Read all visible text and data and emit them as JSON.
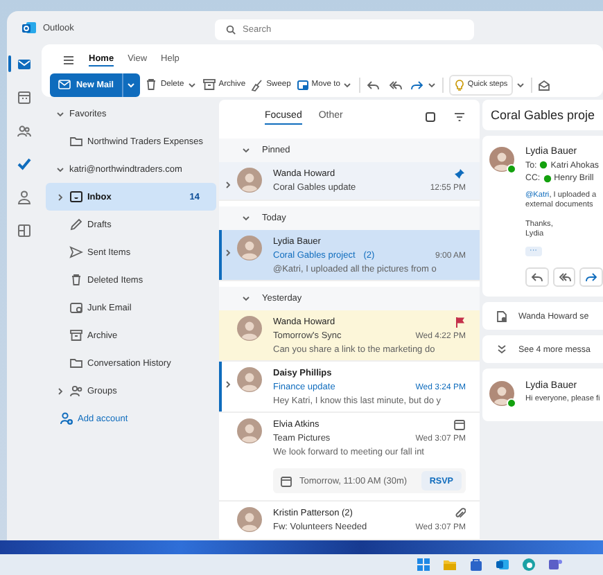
{
  "app": {
    "name": "Outlook"
  },
  "search": {
    "placeholder": "Search"
  },
  "rail": [
    {
      "kind": "mail",
      "selected": true
    },
    {
      "kind": "calendar",
      "selected": false
    },
    {
      "kind": "people",
      "selected": false
    },
    {
      "kind": "todo",
      "selected": false
    },
    {
      "kind": "person",
      "selected": false
    },
    {
      "kind": "apps",
      "selected": false
    }
  ],
  "ribbon": {
    "tabs": [
      {
        "label": "Home",
        "selected": true
      },
      {
        "label": "View",
        "selected": false
      },
      {
        "label": "Help",
        "selected": false
      }
    ],
    "new_mail": "New Mail",
    "actions": [
      {
        "label": "Delete",
        "kind": "trash",
        "dropdown": true
      },
      {
        "label": "Archive",
        "kind": "archive",
        "dropdown": false
      },
      {
        "label": "Sweep",
        "kind": "broom",
        "dropdown": false
      },
      {
        "label": "Move to",
        "kind": "move",
        "dropdown": true
      }
    ],
    "quick_steps": "Quick steps"
  },
  "folders": {
    "favorites": {
      "label": "Favorites",
      "expanded": true,
      "items": [
        {
          "label": "Northwind Traders Expenses",
          "kind": "folder"
        }
      ]
    },
    "account": {
      "label": "katri@northwindtraders.com",
      "expanded": true,
      "items": [
        {
          "label": "Inbox",
          "kind": "inbox",
          "count": "14",
          "selected": true
        },
        {
          "label": "Drafts",
          "kind": "drafts",
          "selected": false
        },
        {
          "label": "Sent Items",
          "kind": "sent",
          "selected": false
        },
        {
          "label": "Deleted Items",
          "kind": "trash",
          "selected": false
        },
        {
          "label": "Junk Email",
          "kind": "junk",
          "selected": false
        },
        {
          "label": "Archive",
          "kind": "archive",
          "selected": false
        },
        {
          "label": "Conversation History",
          "kind": "folder",
          "selected": false
        }
      ]
    },
    "groups": {
      "label": "Groups",
      "expanded": false
    },
    "add_account": "Add account"
  },
  "list": {
    "tabs": [
      {
        "label": "Focused",
        "selected": true
      },
      {
        "label": "Other",
        "selected": false
      }
    ],
    "sections": [
      {
        "label": "Pinned",
        "messages": [
          {
            "sender": "Wanda Howard",
            "subject": "Coral Gables update",
            "time": "12:55 PM",
            "kind": "pinned",
            "selected": false,
            "unread": false,
            "thread": true
          }
        ]
      },
      {
        "label": "Today",
        "messages": [
          {
            "sender": "Lydia Bauer",
            "subject": "Coral Gables project",
            "count": "(2)",
            "time": "9:00 AM",
            "kind": "plain",
            "preview": "@Katri, I uploaded all the pictures from o",
            "selected": true,
            "unread": false,
            "thread": true
          }
        ]
      },
      {
        "label": "Yesterday",
        "messages": [
          {
            "sender": "Wanda Howard",
            "subject": "Tomorrow's Sync",
            "time": "Wed 4:22 PM",
            "preview": "Can you share a link to the marketing do",
            "kind": "flagged",
            "selected": false,
            "unread": false,
            "thread": false
          },
          {
            "sender": "Daisy Phillips",
            "subject": "Finance update",
            "time": "Wed 3:24 PM",
            "kind": "plain",
            "preview": "Hey Katri, I know this last minute, but do y",
            "selected": false,
            "unread": true,
            "thread": true
          },
          {
            "sender": "Elvia Atkins",
            "subject": "Team Pictures",
            "time": "Wed 3:07 PM",
            "preview": "We look forward to meeting our fall int",
            "kind": "event",
            "selected": false,
            "unread": false,
            "thread": false,
            "invite": {
              "when": "Tomorrow, 11:00 AM (30m)",
              "action": "RSVP"
            }
          },
          {
            "sender": "Kristin Patterson (2)",
            "subject": "Fw: Volunteers Needed",
            "time": "Wed 3:07 PM",
            "kind": "attachment",
            "selected": false,
            "unread": false,
            "thread": false
          }
        ]
      }
    ]
  },
  "reading": {
    "subject": "Coral Gables proje",
    "message": {
      "sender": "Lydia Bauer",
      "to_label": "To:",
      "to": "Katri Ahokas",
      "cc_label": "CC:",
      "cc": "Henry Brill",
      "body": [
        {
          "mention": "@Katri",
          "text": ", I uploaded a"
        },
        {
          "text": "external documents"
        }
      ],
      "signoff": [
        "Thanks,",
        "Lydia"
      ],
      "more": "···"
    },
    "collapsed": [
      {
        "kind": "sent",
        "text": "Wanda Howard se"
      },
      {
        "kind": "more",
        "text": "See 4 more messa"
      }
    ],
    "last": {
      "sender": "Lydia Bauer",
      "preview": "Hi everyone, please fi"
    }
  }
}
